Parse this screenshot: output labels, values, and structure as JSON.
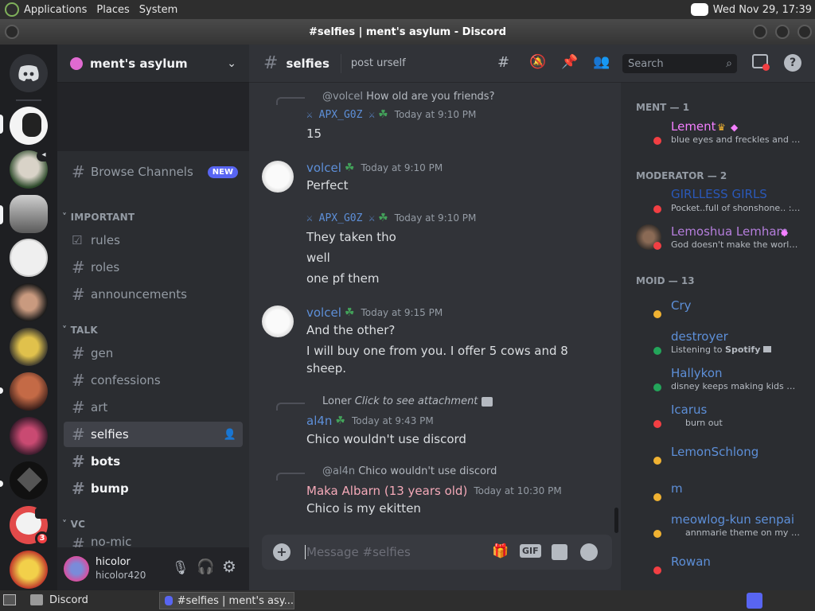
{
  "top_panel": {
    "menus": [
      "Applications",
      "Places",
      "System"
    ],
    "clock": "Wed Nov 29, 17:39"
  },
  "window": {
    "title": "#selfies | ment's asylum - Discord"
  },
  "server": {
    "name": "ment's asylum",
    "mention_badge": "3"
  },
  "sidebar": {
    "browse_channels": "Browse Channels",
    "new_badge": "NEW",
    "categories": {
      "important": "IMPORTANT",
      "talk": "TALK",
      "vc": "VC"
    },
    "channels": {
      "rules": "rules",
      "roles": "roles",
      "announcements": "announcements",
      "gen": "gen",
      "confessions": "confessions",
      "art": "art",
      "selfies": "selfies",
      "bots": "bots",
      "bump": "bump",
      "nomic": "no-mic"
    }
  },
  "user_panel": {
    "display_name": "hicolor",
    "username": "hicolor420"
  },
  "header": {
    "channel": "selfies",
    "topic": "post urself",
    "search_placeholder": "Search"
  },
  "messages": [
    {
      "reply_to": "@volcel",
      "reply_text": "How old are you friends?",
      "author": "⚔ APX_G0Z ⚔",
      "time": "Today at 9:10 PM",
      "lines": [
        "15"
      ]
    },
    {
      "author": "volcel",
      "time": "Today at 9:10 PM",
      "lines": [
        "Perfect"
      ]
    },
    {
      "author": "⚔ APX_G0Z ⚔",
      "time": "Today at 9:10 PM",
      "lines": [
        "They taken tho",
        "well",
        "one pf them"
      ]
    },
    {
      "author": "volcel",
      "time": "Today at 9:15 PM",
      "lines": [
        "And the other?",
        "I will buy one from you. I offer 5 cows and 8",
        "sheep."
      ]
    },
    {
      "reply_to": "Loner",
      "reply_text": "Click to see attachment",
      "author": "al4n",
      "time": "Today at 9:43 PM",
      "lines": [
        "Chico wouldn't use discord"
      ]
    },
    {
      "reply_to": "@al4n",
      "reply_text": "Chico wouldn't use discord",
      "author": "Maka Albarn (13 years old)",
      "time": "Today at 10:30 PM",
      "lines": [
        "Chico is my ekitten"
      ]
    }
  ],
  "composer": {
    "placeholder": "Message #selfies",
    "gif": "GIF"
  },
  "members": {
    "groups": [
      {
        "title": "MENT — 1"
      },
      {
        "title": "MODERATOR — 2"
      },
      {
        "title": "MOID — 13"
      }
    ],
    "list": [
      {
        "name": "Lement",
        "status": "blue eyes and freckles and yo..."
      },
      {
        "name": "GIRLLESS GIRLS",
        "status": "Pocket..full of shonshone.. :) s..."
      },
      {
        "name": "Lemoshua Lemham",
        "status": "God doesn't make the world t..."
      },
      {
        "name": "Cry",
        "status": ""
      },
      {
        "name": "destroyer",
        "status": "Listening to",
        "status_bold": "Spotify"
      },
      {
        "name": "Hallykon",
        "status": "disney keeps making kids mov..."
      },
      {
        "name": "Icarus",
        "status": "burn out"
      },
      {
        "name": "LemonSchlong",
        "status": ""
      },
      {
        "name": "m",
        "status": ""
      },
      {
        "name": "meowlog-kun senpai",
        "status": "annmarie theme on my pa..."
      },
      {
        "name": "Rowan",
        "status": ""
      }
    ]
  },
  "taskbar": {
    "app": "Discord",
    "task": "#selfies | ment's asy..."
  },
  "colors": {
    "accent": "#5865f2",
    "bg": "#313338",
    "sidebar": "#2b2d31",
    "rail": "#1e1f22",
    "dnd": "#f23f43",
    "online": "#23a55a",
    "idle": "#f0b232"
  }
}
